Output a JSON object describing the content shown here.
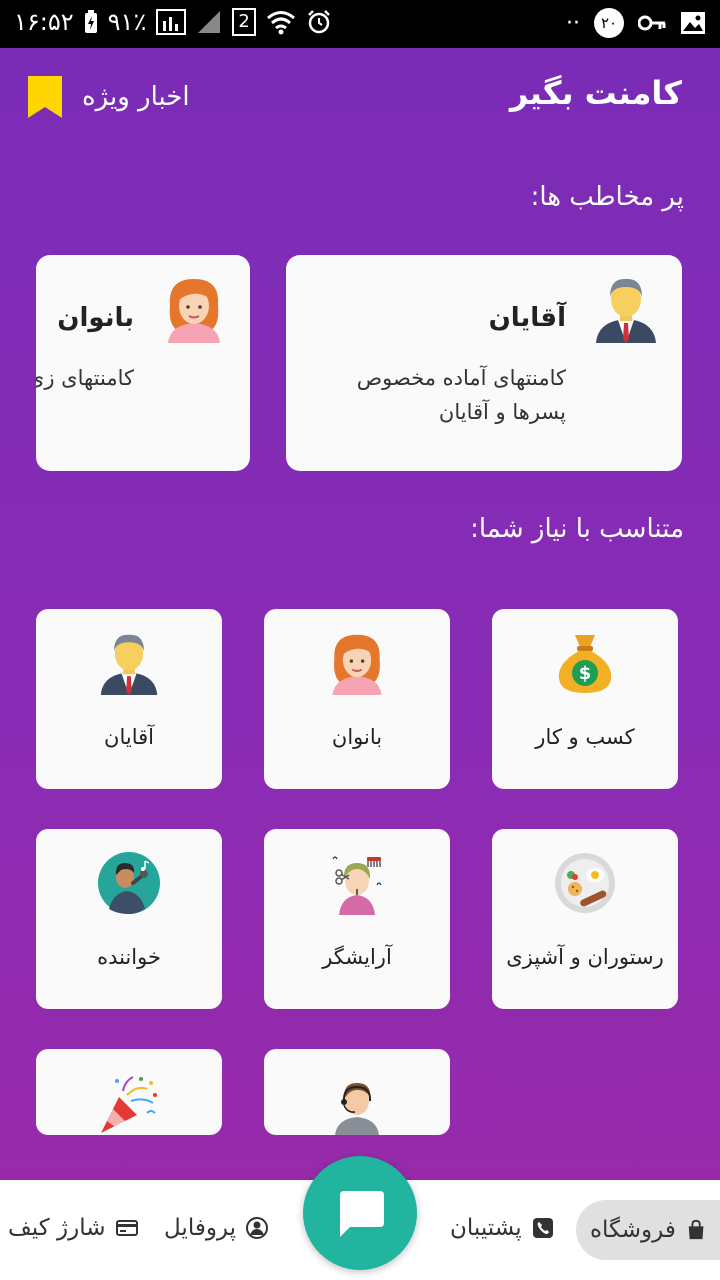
{
  "status_bar": {
    "time": "۱۶:۵۲",
    "battery": "۹۱٪",
    "sim": "2",
    "dots": "··",
    "notif_count": "۲۰"
  },
  "header": {
    "title": "کامنت بگیر",
    "news_label": "اخبار ویژه",
    "bookmark_color": "#ffd600"
  },
  "audience": {
    "section_title": "پر مخاطب ها:",
    "cards": [
      {
        "title": "آقایان",
        "desc_line1": "کامنتهای آماده مخصوص",
        "desc_line2": "پسرها و آقایان",
        "icon": "man-avatar-icon"
      },
      {
        "title": "بانوان",
        "desc_line1": "کامنتهای زی",
        "icon": "woman-avatar-icon"
      }
    ]
  },
  "categories": {
    "section_title": "متناسب با نیاز شما:",
    "items": [
      {
        "label": "کسب  و  کار",
        "icon": "money-bag-icon"
      },
      {
        "label": "بانوان",
        "icon": "woman-avatar-icon"
      },
      {
        "label": "آقایان",
        "icon": "man-avatar-icon"
      },
      {
        "label": "رستوران و آشپزی",
        "icon": "food-plate-icon"
      },
      {
        "label": "آرایشگر",
        "icon": "hairdresser-icon"
      },
      {
        "label": "خواننده",
        "icon": "singer-icon"
      },
      {
        "label": "",
        "icon": "support-agent-icon"
      },
      {
        "label": "",
        "icon": "party-popper-icon"
      }
    ]
  },
  "bottom_nav": {
    "shop": "فروشگاه",
    "support": "پشتیبان",
    "profile": "پروفایل",
    "wallet": "شارژ کیف",
    "fab_icon": "chat-bubble-icon",
    "accent": "#21b5a0"
  }
}
